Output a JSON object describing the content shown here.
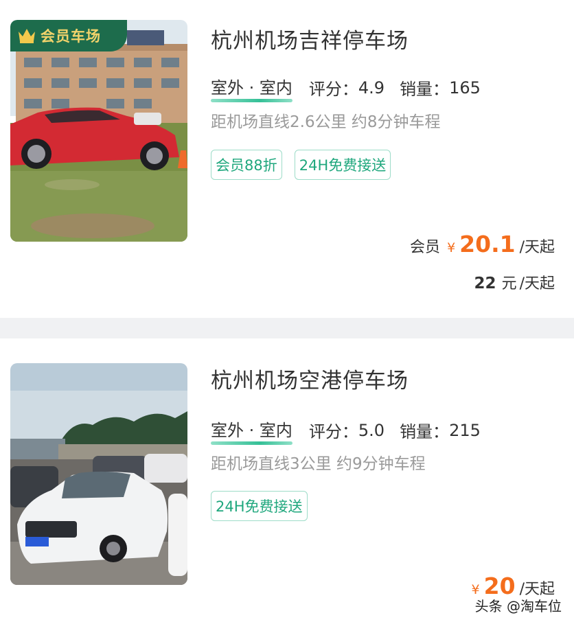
{
  "listings": [
    {
      "badge": "会员车场",
      "title": "杭州机场吉祥停车场",
      "env": "室外 · 室内",
      "rating_label": "评分：",
      "rating": "4.9",
      "sales_label": "销量：",
      "sales": "165",
      "distance": "距机场直线2.6公里 约8分钟车程",
      "tags": [
        "会员88折",
        "24H免费接送"
      ],
      "member_price_label": "会员",
      "currency": "¥",
      "member_price": "20.1",
      "price_suffix": "/天起",
      "normal_price": "22",
      "normal_unit": "元",
      "normal_suffix": "/天起"
    },
    {
      "title": "杭州机场空港停车场",
      "env": "室外 · 室内",
      "rating_label": "评分：",
      "rating": "5.0",
      "sales_label": "销量：",
      "sales": "215",
      "distance": "距机场直线3公里 约9分钟车程",
      "tags": [
        "24H免费接送"
      ],
      "currency": "¥",
      "price": "20",
      "price_suffix": "/天起"
    }
  ],
  "watermark": "头条 @淘车位",
  "colors": {
    "accent": "#f46d1c",
    "tag_green": "#1fa77d",
    "badge_bg": "#1d6c4c",
    "badge_text": "#f2d36b"
  },
  "icons": [
    "crown-icon"
  ]
}
